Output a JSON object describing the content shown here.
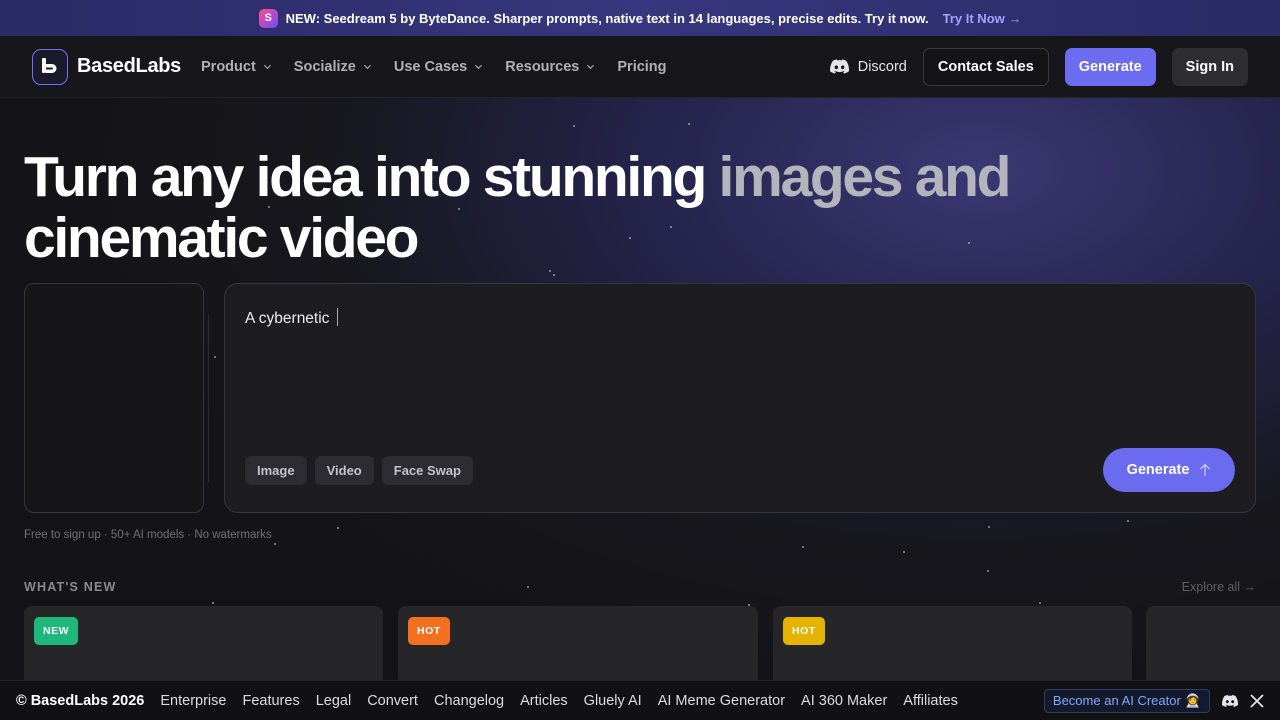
{
  "announcement": {
    "text": "NEW: Seedream 5 by ByteDance. Sharper prompts, native text in 14 languages, precise edits. Try it now.",
    "link": "Try It Now →",
    "logo_glyph": "S"
  },
  "nav": {
    "brand": "BasedLabs",
    "menu": [
      "Product",
      "Socialize",
      "Use Cases",
      "Resources",
      "Pricing"
    ],
    "discord": "Discord",
    "contact_sales": "Contact Sales",
    "generate": "Generate",
    "sign_in": "Sign In"
  },
  "hero": {
    "title_bright": "Turn any idea into stunning",
    "title_dim": "images and",
    "title_line2": "cinematic video"
  },
  "prompt": {
    "typed_text": "A cybernetic",
    "modes": [
      "Image",
      "Video",
      "Face Swap"
    ],
    "generate": "Generate",
    "footnote": "Free to sign up · 50+ AI models · No watermarks"
  },
  "whats_new": {
    "heading": "WHAT'S NEW",
    "explore": "Explore all →",
    "badges": [
      "NEW",
      "HOT",
      "HOT"
    ],
    "badge_colors": [
      "#1db87a",
      "#f2701f",
      "#e6b400"
    ]
  },
  "footer": {
    "copyright": "© BasedLabs 2026",
    "links": [
      "Enterprise",
      "Features",
      "Legal",
      "Convert",
      "Changelog",
      "Articles",
      "Gluely AI",
      "AI Meme Generator",
      "AI 360 Maker",
      "Affiliates"
    ],
    "creator": "Become an AI Creator",
    "creator_emoji": "🧑‍🚀"
  },
  "colors": {
    "accent": "#6c6cf0",
    "announce_link": "#9ea4ff"
  }
}
